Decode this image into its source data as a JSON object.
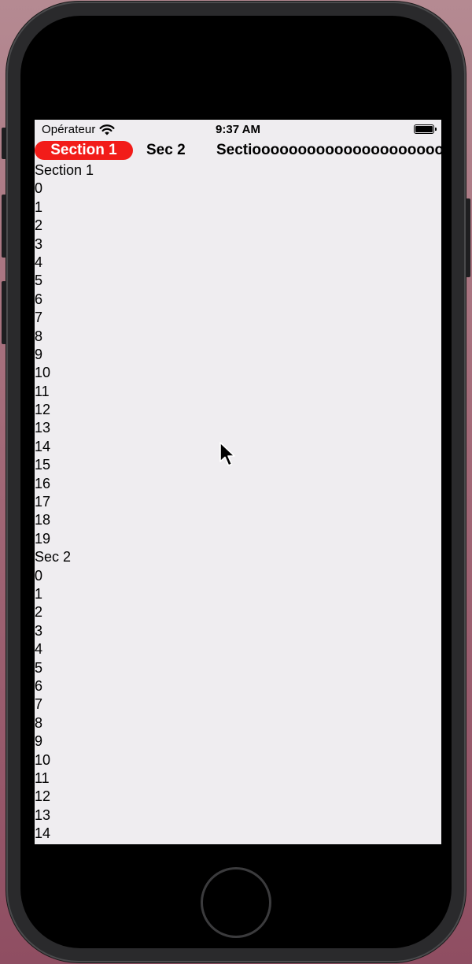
{
  "status_bar": {
    "carrier": "Opérateur",
    "time": "9:37 AM",
    "wifi_icon": "wifi-icon",
    "battery_icon": "battery-icon"
  },
  "tabs": [
    {
      "label": "Section 1",
      "active": true
    },
    {
      "label": "Sec 2",
      "active": false
    },
    {
      "label": "Sectioooooooooooooooooooooo",
      "active": false
    }
  ],
  "sections": [
    {
      "title": "Section 1",
      "items": [
        "0",
        "1",
        "2",
        "3",
        "4",
        "5",
        "6",
        "7",
        "8",
        "9",
        "10",
        "11",
        "12",
        "13",
        "14",
        "15",
        "16",
        "17",
        "18",
        "19"
      ]
    },
    {
      "title": "Sec 2",
      "items": [
        "0",
        "1",
        "2",
        "3",
        "4",
        "5",
        "6",
        "7",
        "8",
        "9",
        "10",
        "11",
        "12",
        "13",
        "14"
      ]
    }
  ],
  "colors": {
    "active_tab_background": "#f21c19",
    "screen_background": "#efedf0"
  }
}
